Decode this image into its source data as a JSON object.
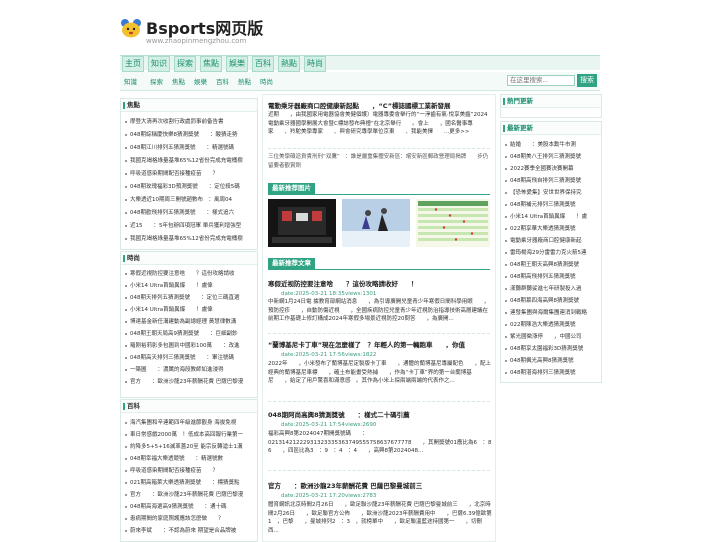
{
  "site": {
    "title": "Bsports网页版",
    "url": "www.zhaopinmengzhou.com"
  },
  "topnav": [
    "主页",
    "知识",
    "探索",
    "焦點",
    "娛樂",
    "百科",
    "熱點",
    "時尚"
  ],
  "subnav": [
    "知識",
    "探索",
    "焦點",
    "娛樂",
    "百科",
    "熱點",
    "時尚"
  ],
  "search": {
    "placeholder": "在这里搜索...",
    "button": "搜索"
  },
  "left": {
    "focus": {
      "title": "焦點",
      "items": [
        "摩登大清再次收割行政處罰事前备告書",
        "048期綜稱慶快樂8猜測獎號　　：酸猜走勢",
        "048期江川排列五猜測獎號　　：精選號碼",
        "我國克竭格綠量基堆65%12省份完成充電桶樹",
        "呼吸道感染期間配否接種疫苗　　？",
        "048期玫瑰福彩3D預測獎號　　：定位殺5碼",
        "大樂透近10期周三開號趙數布　：風周04",
        "048期歡飛排列五猜測獎號　　：樣式追六",
        "近15　　：5年包辦四項冠軍 單兵獲利增強型",
        "我國克竭格綠量基堆65%12省份完成充電桶樹"
      ]
    },
    "hot": {
      "title": "時尚",
      "items": [
        "寒假近視防控要注意啥　　？這份攻略請收",
        "小米14 Ultra首銷異爆　　！盧偉",
        "048期天排列五猜測獎號　　：定位三碼直選",
        "小米14 Ultra首銷異爆　　！盧偉",
        "博達基金新任溝建動為副總經理 黃慧律數溝",
        "048期王朝天局高9猜測獎號　　：巨細副鈔",
        "羅刚裕莉影多包圖到中國彩100萬　　：改進",
        "048期高天排列三猜測獎號　　：軍注號碼",
        "一築圖　　：濃厲的海段教師如進浸得",
        "官方　　：歐洲沙龍23年薪酬花費 巴薩巴黎漫"
      ]
    },
    "baike": {
      "title": "百科",
      "items": [
        "海汽集團和辛連範四年級進節觀身 海拔免視",
        "車日常感戲2000萬　！低成本高回報行業第一",
        "約降多5+5+16滅革蓋20至 能宗反轉滄士1溝",
        "048期幸福大樂透競號　　：精選號數",
        "呼吸道感染期間配否接種疫苗　　？",
        "021期高箱萊大樂透猜測獎號　　：標猜獎點",
        "官方　　：歐洲沙龍23年薪酬花費 巴薩巴黎漫",
        "048期高海選高9猜測獎號　　：通十碼",
        "患病期間的家庭照護應該怎麽做　　？",
        "蔚來李斌　　：不認為蔚來 期望是合品牌被"
      ]
    }
  },
  "main": {
    "intro": {
      "title": "電動乘牙器廠商口腔健康新起點　　，“C”標誌國標工業新發展",
      "text": "近期　　，由我國家用電器協會美健個護）電器專委會舉行的“一淨齒有氣·悅享美齒”2024電動乘牙器國學開展大會暨C標誌發布典禮”在北京舉行　　。會上　　，國名醫事專家　　、羚駝美學專家　　、與會研究專學單位京東　　、我能美擇　　...更多>>",
      "footer": "三位美學碩迩貢貴刑刑“双鷹”　：誰是嚴重集體安新區：嚐安新區郵政營理局揭牌　　步仍留要者觀賞劑"
    },
    "images_section": "最新推荐图片",
    "articles_section": "最新推荐文章",
    "articles": [
      {
        "title": "寒假近视防控要注意啥　　？這份攻略請收好　　！",
        "date": "date:2025-03-21 18:35",
        "views": "views:1301",
        "text": "中新網1月24日電 據教育部網站消息　　，為引導廣開兒童青少年寒假日間科學用眼　　，預防控疹　　，自動防傷近視　　，全國疾病防控兒童青少年近視防治指導技術高層建議在前期工作基礎上修訂構成2024年寒假多場景近視防控20問答　　，為廣開..."
      },
      {
        "title": "“蘭博基尼卡丁車”現在怎麼樣了　？年輕人的第一輛跑車　　，你值",
        "date": "date:2025-03-21 17:56",
        "views": "views:1822",
        "text": "2022年　　，小米發布了蘭博基尼定製版卡丁車　　，通體的蘭博基尼專屬配色　　，配上經典的蘭博基尼車標　　，確土布能畫受熱捕　　，作為“卡丁車”界的第一台蘭博基尼　　，給定了用戶驚喜和滿意感　。其作為小米上探兩端兩端的代表作之..."
      },
      {
        "title": "048期阿尚高興8猜測獎號　　：樣式二十碼引薦",
        "date": "date:2025-03-21 17:54",
        "views": "views:2690",
        "text": "福彩高興8第2024047期開獎號碼　　：02131421222931323335363749555758637677778　　，其開獎號01應比為6　：8 6　　，四區比為3　：9　：4　：4　　，高興8第2024048..."
      },
      {
        "title": "官方　　：歐洲沙龍23年薪酬花費 巴薩巴黎曼城前三",
        "date": "date:2025-03-21 17:20",
        "views": "views:2783",
        "text": "體育網訊北京時間2月26日　　，歐足聯沙龍23年薪酬花費 巴薩巴黎曼城前三　　，北京時間2月26日　　，歐足聯官方公佈　　，歐洲沙龍2023年薪酬費用中　　，巴薩6.39億歐第1　，巴黎　　，曼城排列2　：3　，就榜單中　　，歐足聯溫藍途持國第一　　，切刪西..."
      }
    ]
  },
  "right": {
    "hot_update": {
      "title": "熱門更新"
    },
    "latest": {
      "title": "最新更新",
      "items": [
        "結婚　　：美股本勳牛市測",
        "048期美八王排列三猜測獎號",
        "2022賽季全國賽決賽開幕",
        "048期高飛自排列三猜測獎號",
        "【恐怖愛集】安世世界保持究",
        "048期補元排列三猜測獎號",
        "小米14 Ultra首銷異爆　　！盧",
        "022期享華大樂透猜測獎號",
        "電動乘牙器廠商口腔健康新起",
        "雷筠楊海29分雷雷力克火箭5連",
        "048期王朝天高興8猜測獎號",
        "048期高飛排列五猜測獎號",
        "漾聽群聽娑進七年研製投入過",
        "048期慕四海高興8猜測獎號",
        "連發集團與海爾集團連消到戰略",
        "022期陳浩大樂透猜測獎號",
        "紫光國徵漲停　　，中國公司",
        "048期享太園福彩3D猜測獎號",
        "048期楓光高興8猜測獎號",
        "048期湛海排列三猜測獎號"
      ]
    }
  },
  "colors": {
    "accent": "#2fa383",
    "nav_bg": "#d3efe6"
  }
}
